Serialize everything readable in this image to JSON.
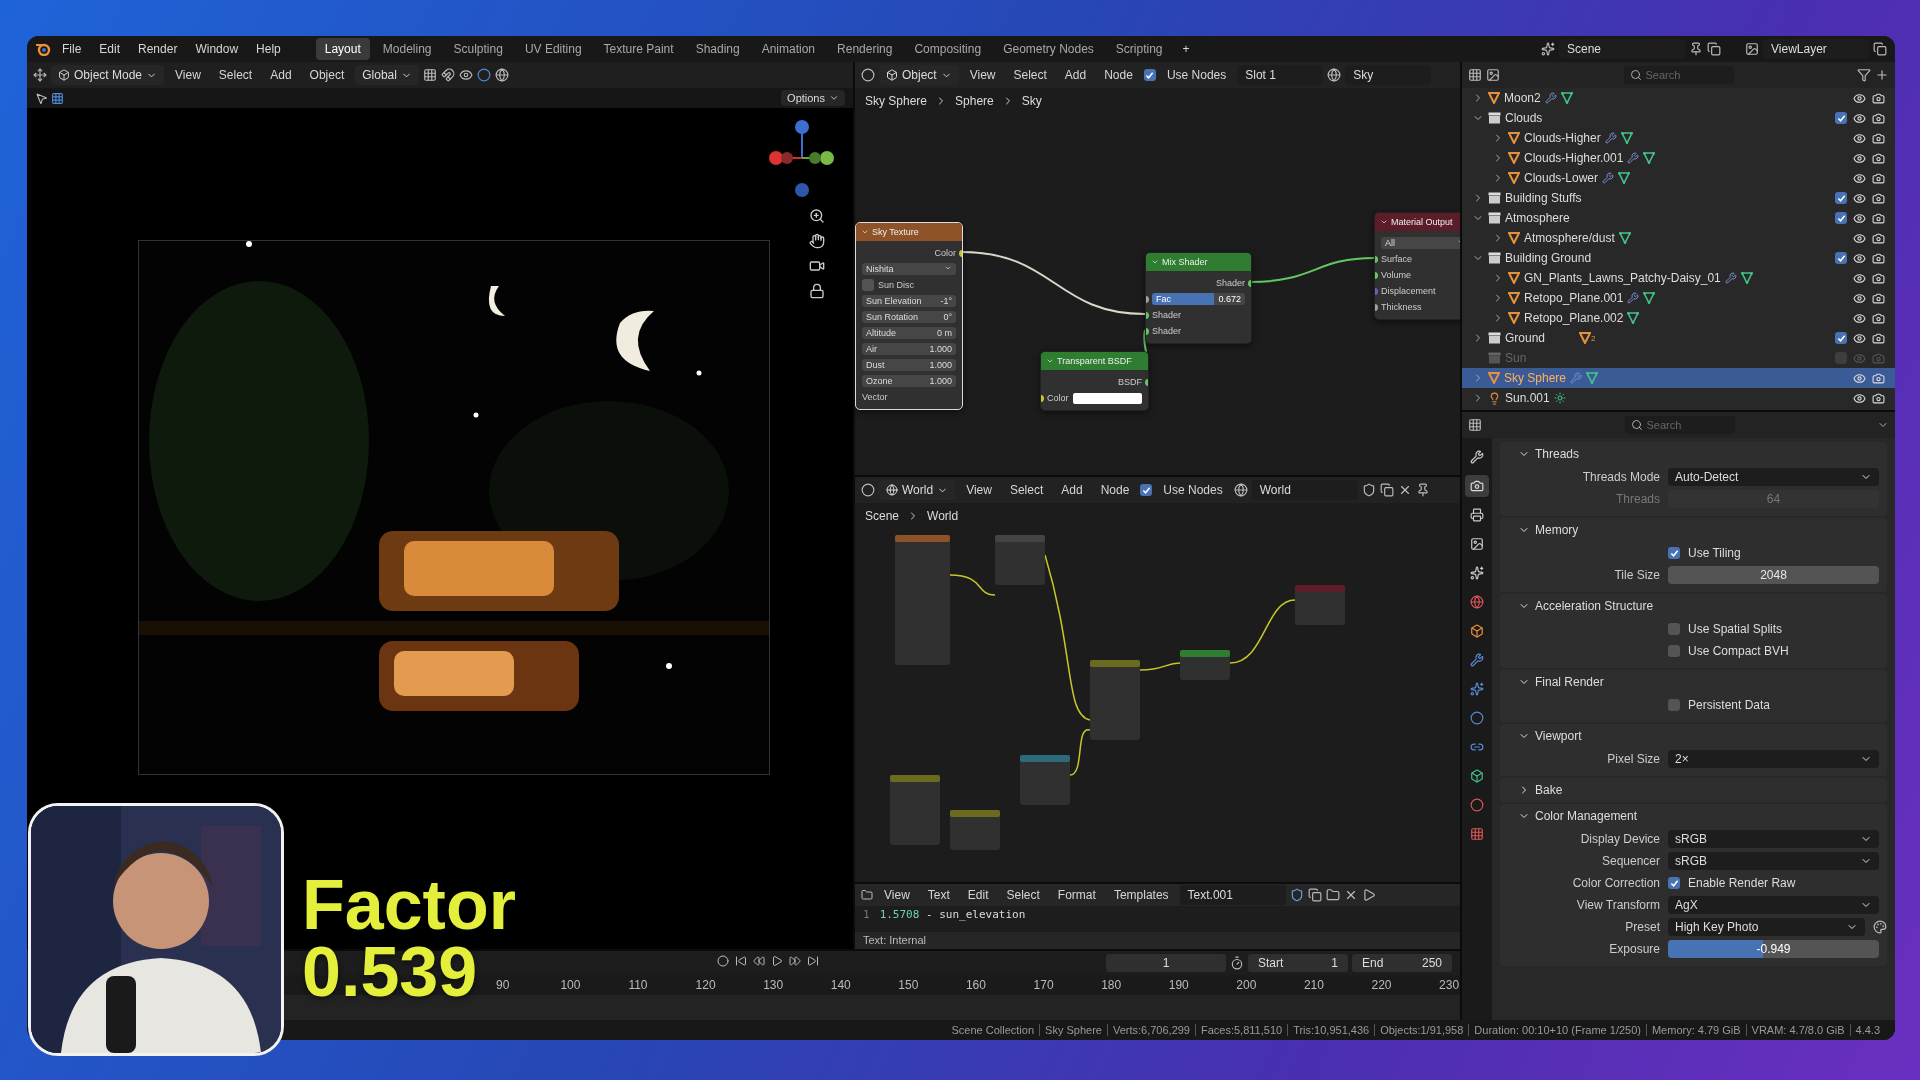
{
  "top_bar": {
    "menus": [
      "File",
      "Edit",
      "Render",
      "Window",
      "Help"
    ],
    "workspaces": [
      {
        "label": "Layout",
        "selected": true
      },
      {
        "label": "Modeling",
        "selected": false
      },
      {
        "label": "Sculpting",
        "selected": false
      },
      {
        "label": "UV Editing",
        "selected": false
      },
      {
        "label": "Texture Paint",
        "selected": false
      },
      {
        "label": "Shading",
        "selected": false
      },
      {
        "label": "Animation",
        "selected": false
      },
      {
        "label": "Rendering",
        "selected": false
      },
      {
        "label": "Compositing",
        "selected": false
      },
      {
        "label": "Geometry Nodes",
        "selected": false
      },
      {
        "label": "Scripting",
        "selected": false
      }
    ],
    "add_workspace": "+",
    "scene": "Scene",
    "view_layer": "ViewLayer"
  },
  "viewport": {
    "mode": "Object Mode",
    "menus": [
      "View",
      "Select",
      "Add",
      "Object"
    ],
    "orientation": "Global",
    "options": "Options"
  },
  "shader_editor": {
    "object_type": "Object",
    "menus": [
      "View",
      "Select",
      "Add",
      "Node"
    ],
    "use_nodes": {
      "label": "Use Nodes",
      "checked": true
    },
    "slot": "Slot 1",
    "material": "Sky",
    "breadcrumbs": [
      "Sky Sphere",
      "Sphere",
      "Sky"
    ],
    "nodes": [
      {
        "title": "Sky Texture",
        "kind": "texture",
        "rows": [
          {
            "kind": "output",
            "label": "Color",
            "socket": {
              "color": "#c7c729"
            }
          },
          {
            "kind": "dropdown",
            "value": "Nishita"
          },
          {
            "kind": "checkbox",
            "label": "Sun Disc",
            "checked": false
          },
          {
            "kind": "field",
            "label": "Sun Elevation",
            "value": "-1°"
          },
          {
            "kind": "field",
            "label": "Sun Rotation",
            "value": "0°"
          },
          {
            "kind": "field",
            "label": "Altitude",
            "value": "0 m"
          },
          {
            "kind": "field",
            "label": "Air",
            "value": "1.000"
          },
          {
            "kind": "field",
            "label": "Dust",
            "value": "1.000"
          },
          {
            "kind": "field",
            "label": "Ozone",
            "value": "1.000"
          },
          {
            "kind": "input",
            "label": "Vector"
          }
        ]
      },
      {
        "title": "Mix Shader",
        "kind": "shader",
        "rows": [
          {
            "kind": "output",
            "label": "Shader",
            "socket": {
              "color": "#63c763"
            }
          },
          {
            "kind": "slider",
            "label": "Fac",
            "value": "0.672",
            "level": 0.672,
            "socket": {
              "color": "#a1a1a1"
            }
          },
          {
            "kind": "input",
            "label": "Shader",
            "socket": {
              "color": "#63c763"
            }
          },
          {
            "kind": "input",
            "label": "Shader",
            "socket": {
              "color": "#63c763"
            }
          }
        ]
      },
      {
        "title": "Transparent BSDF",
        "kind": "shader",
        "rows": [
          {
            "kind": "output",
            "label": "BSDF",
            "socket": {
              "color": "#63c763"
            }
          },
          {
            "kind": "color",
            "label": "Color",
            "color": "#ffffff",
            "socket": {
              "color": "#c7c729"
            }
          }
        ]
      },
      {
        "title": "Material Output",
        "kind": "output",
        "rows": [
          {
            "kind": "dropdown",
            "value": "All"
          },
          {
            "kind": "input",
            "label": "Surface",
            "socket": {
              "color": "#63c763"
            }
          },
          {
            "kind": "input",
            "label": "Volume",
            "socket": {
              "color": "#63c763"
            }
          },
          {
            "kind": "input",
            "label": "Displacement",
            "socket": {
              "color": "#6363c7"
            }
          },
          {
            "kind": "input",
            "label": "Thickness",
            "socket": {
              "color": "#a1a1a1"
            }
          }
        ]
      }
    ]
  },
  "world_editor": {
    "world": "World",
    "menus": [
      "View",
      "Select",
      "Add",
      "Node"
    ],
    "use_nodes": {
      "label": "Use Nodes",
      "checked": true
    },
    "world_name": "World",
    "breadcrumbs": [
      "Scene",
      "World"
    ]
  },
  "text_editor": {
    "menus": [
      "View",
      "Text",
      "Edit",
      "Select",
      "Format",
      "Templates"
    ],
    "text_name": "Text.001",
    "lines": [
      {
        "number": "1",
        "value": "1.5708",
        "comment": "- sun_elevation"
      }
    ],
    "footer": "Text: Internal"
  },
  "timeline": {
    "frame": "1",
    "start_label": "Start",
    "start": "1",
    "end_label": "End",
    "end": "250",
    "ruler": [
      "90",
      "100",
      "110",
      "120",
      "130",
      "140",
      "150",
      "160",
      "170",
      "180",
      "190",
      "200",
      "210",
      "220",
      "230"
    ]
  },
  "outliner": {
    "search": {
      "placeholder": "Search"
    },
    "items": [
      {
        "name": "Moon2",
        "kind": "object",
        "selected": false,
        "modifier": true
      },
      {
        "name": "Clouds",
        "kind": "collection",
        "expanded": true,
        "checked": true,
        "selected": false,
        "children": [
          {
            "name": "Clouds-Higher",
            "kind": "object",
            "selected": false,
            "modifier": true
          },
          {
            "name": "Clouds-Higher.001",
            "kind": "object",
            "selected": false,
            "modifier": true
          },
          {
            "name": "Clouds-Lower",
            "kind": "object",
            "selected": false,
            "modifier": true
          }
        ]
      },
      {
        "name": "Building Stuffs",
        "kind": "collection",
        "expanded": false,
        "checked": true,
        "selected": false
      },
      {
        "name": "Atmosphere",
        "kind": "collection",
        "expanded": true,
        "checked": true,
        "selected": false,
        "children": [
          {
            "name": "Atmosphere/dust",
            "kind": "object",
            "selected": false,
            "modifier": false
          }
        ]
      },
      {
        "name": "Building Ground",
        "kind": "collection",
        "expanded": true,
        "checked": true,
        "selected": false,
        "children": [
          {
            "name": "GN_Plants_Lawns_Patchy-Daisy_01",
            "kind": "object",
            "selected": false,
            "modifier": true
          },
          {
            "name": "Retopo_Plane.001",
            "kind": "object",
            "selected": false,
            "modifier": true
          },
          {
            "name": "Retopo_Plane.002",
            "kind": "object",
            "selected": false,
            "modifier": false
          }
        ]
      },
      {
        "name": "Ground",
        "kind": "collection",
        "expanded": false,
        "checked": true,
        "selected": false,
        "count": "2"
      },
      {
        "name": "Sun",
        "kind": "collection",
        "checked": false,
        "selected": false
      },
      {
        "name": "Sky Sphere",
        "kind": "object",
        "selected": true,
        "modifier": true
      },
      {
        "name": "Sun.001",
        "kind": "light",
        "selected": false
      }
    ]
  },
  "properties": {
    "search": {
      "placeholder": "Search"
    },
    "tabs": [
      {
        "kind": "tool",
        "selected": false
      },
      {
        "kind": "render",
        "selected": true
      },
      {
        "kind": "output",
        "selected": false
      },
      {
        "kind": "view_layer",
        "selected": false
      },
      {
        "kind": "scene",
        "selected": false
      },
      {
        "kind": "world",
        "selected": false
      },
      {
        "kind": "object",
        "selected": false
      },
      {
        "kind": "modifier",
        "selected": false
      },
      {
        "kind": "particles",
        "selected": false
      },
      {
        "kind": "physics",
        "selected": false
      },
      {
        "kind": "constraint",
        "selected": false
      },
      {
        "kind": "data",
        "selected": false
      },
      {
        "kind": "material",
        "selected": false
      },
      {
        "kind": "texture",
        "selected": false
      }
    ],
    "panels": [
      {
        "title": "Threads",
        "expanded": true,
        "rows": [
          {
            "kind": "dropdown",
            "label": "Threads Mode",
            "value": "Auto-Detect"
          },
          {
            "kind": "field",
            "label": "Threads",
            "value": "64",
            "disabled": true
          }
        ]
      },
      {
        "title": "Memory",
        "expanded": true,
        "rows": [
          {
            "kind": "checkbox",
            "label": "Use Tiling",
            "checked": true
          },
          {
            "kind": "field",
            "label": "Tile Size",
            "value": "2048",
            "disabled": false
          }
        ]
      },
      {
        "title": "Acceleration Structure",
        "expanded": true,
        "rows": [
          {
            "kind": "checkbox",
            "label": "Use Spatial Splits",
            "checked": false
          },
          {
            "kind": "checkbox",
            "label": "Use Compact BVH",
            "checked": false
          }
        ]
      },
      {
        "title": "Final Render",
        "expanded": true,
        "rows": [
          {
            "kind": "checkbox",
            "label": "Persistent Data",
            "checked": false
          }
        ]
      },
      {
        "title": "Viewport",
        "expanded": true,
        "rows": [
          {
            "kind": "dropdown",
            "label": "Pixel Size",
            "value": "2×"
          }
        ]
      },
      {
        "title": "Bake",
        "expanded": false
      },
      {
        "title": "Color Management",
        "expanded": true,
        "rows": [
          {
            "kind": "dropdown",
            "label": "Display Device",
            "value": "sRGB"
          },
          {
            "kind": "dropdown",
            "label": "Sequencer",
            "value": "sRGB"
          },
          {
            "kind": "checkbox",
            "caption": "Color Correction",
            "label": "Enable Render Raw",
            "checked": true
          },
          {
            "kind": "dropdown",
            "label": "View Transform",
            "value": "AgX"
          },
          {
            "kind": "preset",
            "label": "Preset",
            "value": "High Key Photo"
          },
          {
            "kind": "slider",
            "label": "Exposure",
            "value": "-0.949",
            "level": 0.45
          }
        ]
      }
    ]
  },
  "status_bar": [
    "Scene Collection",
    "Sky Sphere",
    "Verts:6,706,299",
    "Faces:5,811,510",
    "Tris:10,951,436",
    "Objects:1/91,958",
    "Duration: 00:10+10 (Frame 1/250)",
    "Memory: 4.79 GiB",
    "VRAM: 4.7/8.0 GiB",
    "4.4.3"
  ],
  "overlay": {
    "caption": "Factor",
    "value": "0.539"
  }
}
